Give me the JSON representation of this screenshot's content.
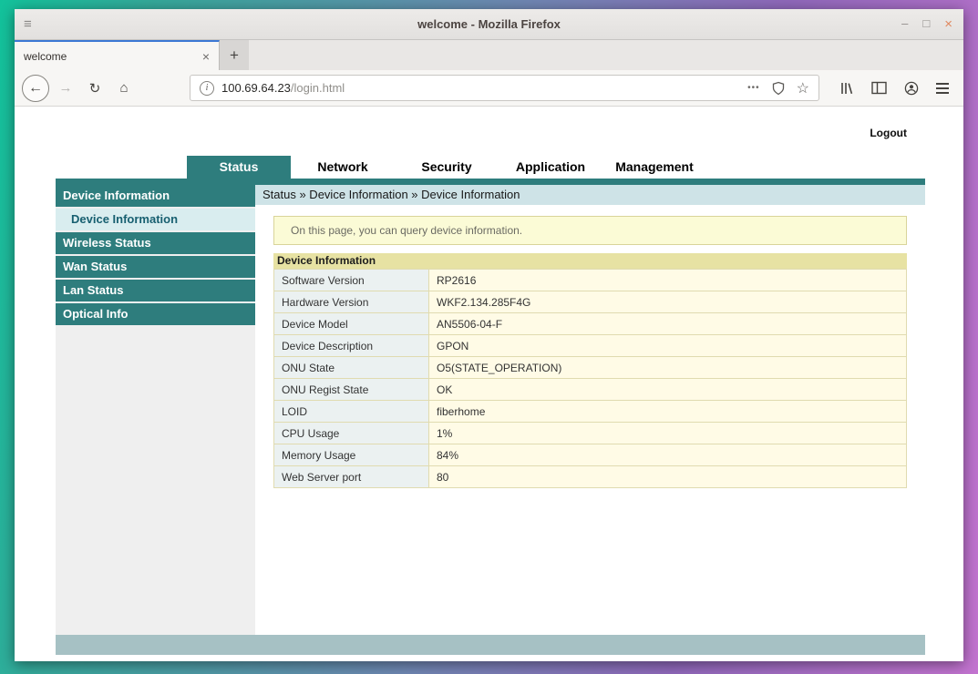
{
  "window": {
    "title": "welcome - Mozilla Firefox",
    "menu_icon": "≡",
    "controls": {
      "minimize": "–",
      "maximize": "□",
      "close": "×"
    }
  },
  "tabs": {
    "active_tab": {
      "title": "welcome",
      "close": "×"
    },
    "new_tab_button": "+"
  },
  "toolbar": {
    "back_icon": "←",
    "forward_icon": "→",
    "reload_icon": "↻",
    "home_icon": "⌂",
    "info_icon": "i",
    "url_host": "100.69.64.23",
    "url_path": "/login.html",
    "overflow_icon": "•••",
    "star_icon": "☆"
  },
  "page": {
    "logout_label": "Logout",
    "nav_tabs": [
      {
        "label": "Status"
      },
      {
        "label": "Network"
      },
      {
        "label": "Security"
      },
      {
        "label": "Application"
      },
      {
        "label": "Management"
      }
    ],
    "sidebar": [
      {
        "label": "Device Information"
      },
      {
        "label": "Device Information"
      },
      {
        "label": "Wireless Status"
      },
      {
        "label": "Wan Status"
      },
      {
        "label": "Lan Status"
      },
      {
        "label": "Optical Info"
      }
    ],
    "breadcrumb": "Status » Device Information » Device Information",
    "notice": "On this page, you can query device information.",
    "table": {
      "title": "Device Information",
      "rows": [
        {
          "label": "Software Version",
          "value": "RP2616"
        },
        {
          "label": "Hardware Version",
          "value": "WKF2.134.285F4G"
        },
        {
          "label": "Device Model",
          "value": "AN5506-04-F"
        },
        {
          "label": "Device Description",
          "value": "GPON"
        },
        {
          "label": "ONU State",
          "value": "O5(STATE_OPERATION)"
        },
        {
          "label": "ONU Regist State",
          "value": "OK"
        },
        {
          "label": "LOID",
          "value": "fiberhome"
        },
        {
          "label": "CPU Usage",
          "value": "1%"
        },
        {
          "label": "Memory Usage",
          "value": "84%"
        },
        {
          "label": "Web Server port",
          "value": "80"
        }
      ]
    }
  },
  "colors": {
    "accent_teal": "#2e7d7d",
    "tab_active_blue": "#3b78d4",
    "breadcrumb_bg": "#cee3e7",
    "notice_bg": "#fbfbd6",
    "table_title_bg": "#e7e2a3",
    "label_cell_bg": "#ebf1f1",
    "value_cell_bg": "#fffbe6"
  }
}
